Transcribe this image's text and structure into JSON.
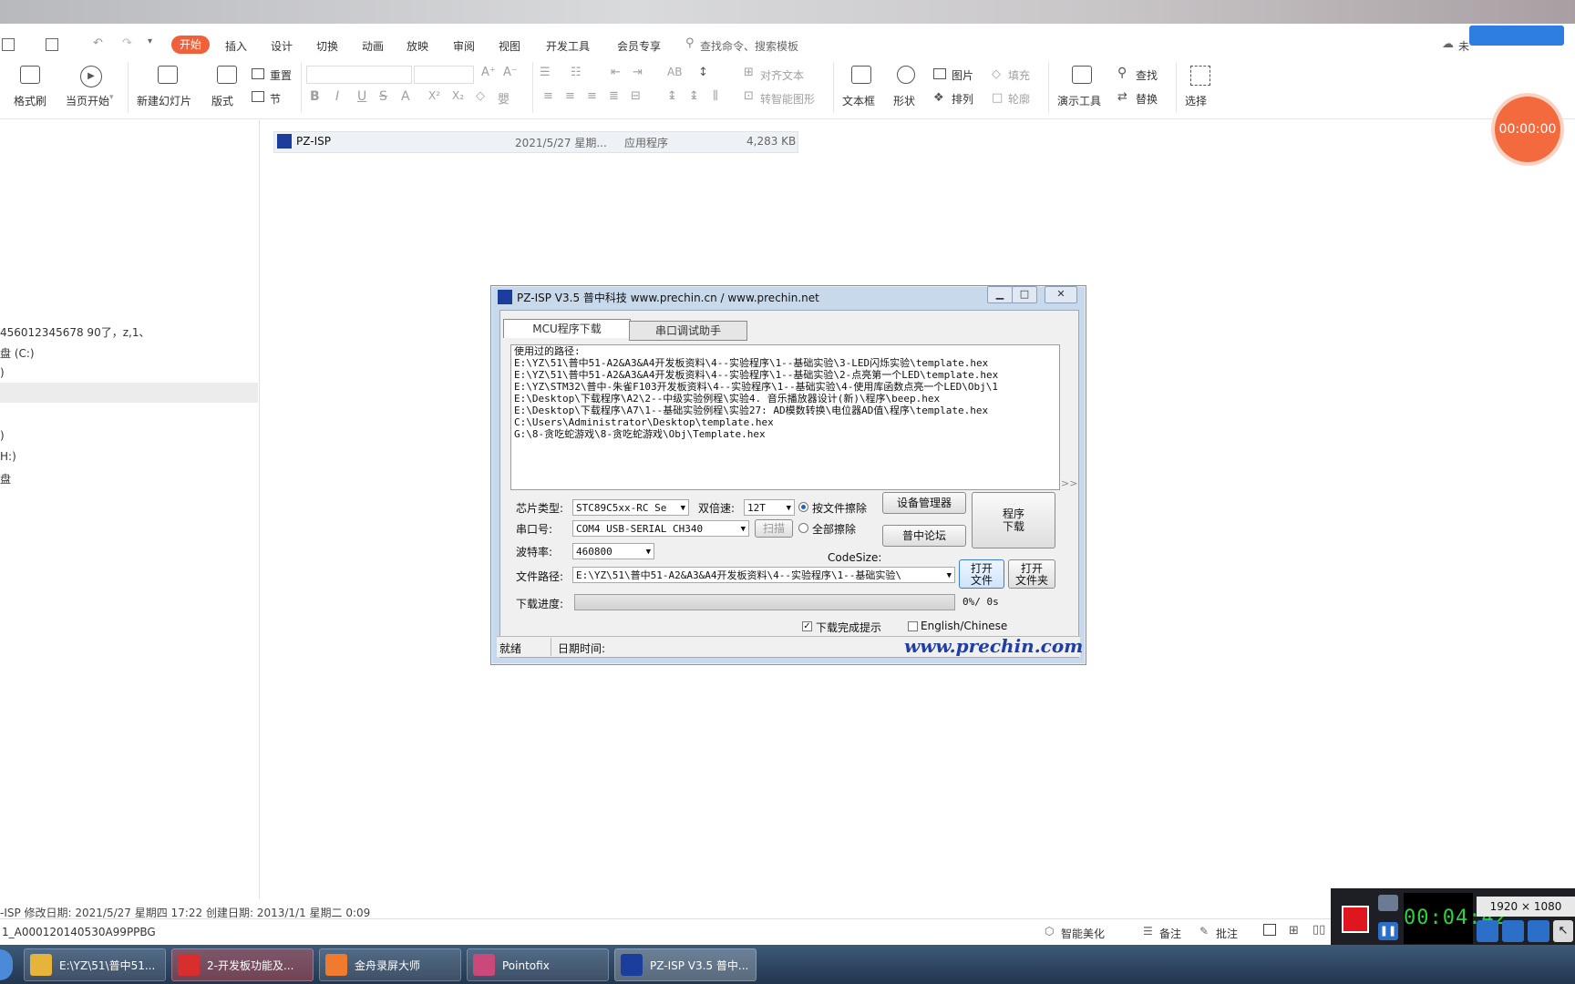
{
  "menu": {
    "items": [
      "开始",
      "插入",
      "设计",
      "切换",
      "动画",
      "放映",
      "审阅",
      "视图",
      "开发工具",
      "会员专享"
    ],
    "search": "查找命令、搜索模板",
    "top_right": "未"
  },
  "ribbon": {
    "format_painter": "格式刷",
    "start_from_current": "当页开始",
    "new_slide": "新建幻灯片",
    "layout": "版式",
    "reset": "重置",
    "section": "节",
    "align_text": "对齐文本",
    "convert_shape": "转智能图形",
    "textbox": "文本框",
    "shape": "形状",
    "picture": "图片",
    "fill": "填充",
    "arrange": "排列",
    "outline": "轮廓",
    "present_tools": "演示工具",
    "find": "查找",
    "replace": "替换",
    "select": "选择"
  },
  "recording_timer": "00:00:00",
  "left_panel": {
    "rows": [
      "456012345678 90了，z,1、",
      "盘 (C:)",
      ")",
      "",
      ")",
      "H:)",
      "盘"
    ]
  },
  "file_row": {
    "name": "PZ-ISP",
    "date": "2021/5/27 星期...",
    "type": "应用程序",
    "size": "4,283 KB"
  },
  "dialog": {
    "title": "PZ-ISP V3.5 普中科技 www.prechin.cn / www.prechin.net",
    "tab_download": "MCU程序下载",
    "tab_serial": "串口调试助手",
    "paths_header": "使用过的路径:",
    "paths": [
      "E:\\YZ\\51\\普中51-A2&A3&A4开发板资料\\4--实验程序\\1--基础实验\\3-LED闪烁实验\\template.hex",
      "E:\\YZ\\51\\普中51-A2&A3&A4开发板资料\\4--实验程序\\1--基础实验\\2-点亮第一个LED\\template.hex",
      "E:\\YZ\\STM32\\普中-朱雀F103开发板资料\\4--实验程序\\1--基础实验\\4-使用库函数点亮一个LED\\Obj\\1",
      "E:\\Desktop\\下载程序\\A2\\2--中级实验例程\\实验4. 音乐播放器设计(新)\\程序\\beep.hex",
      "E:\\Desktop\\下载程序\\A7\\1--基础实验例程\\实验27: AD模数转换\\电位器AD值\\程序\\template.hex",
      "C:\\Users\\Administrator\\Desktop\\template.hex",
      "G:\\8-贪吃蛇游戏\\8-贪吃蛇游戏\\Obj\\Template.hex"
    ],
    "chip_label": "芯片类型:",
    "chip_value": "STC89C5xx-RC Se",
    "speed_label": "双倍速:",
    "speed_value": "12T",
    "erase_by_file": "按文件擦除",
    "erase_all": "全部擦除",
    "device_manager": "设备管理器",
    "forum": "普中论坛",
    "program_download": "程序\n下载",
    "port_label": "串口号:",
    "port_value": "COM4  USB-SERIAL CH340",
    "scan": "扫描",
    "baud_label": "波特率:",
    "baud_value": "460800",
    "codesize": "CodeSize:",
    "filepath_label": "文件路径:",
    "filepath_value": "E:\\YZ\\51\\普中51-A2&A3&A4开发板资料\\4--实验程序\\1--基础实验\\",
    "open_file": "打开\n文件",
    "open_folder": "打开\n文件夹",
    "progress_label": "下载进度:",
    "progress_text": "0%/ 0s",
    "progress_value": 0,
    "done_tip": "下载完成提示",
    "lang": "English/Chinese",
    "status_ready": "就绪",
    "status_datetime": "日期时间:",
    "logo": "www.prechin.com",
    "expander": ">>"
  },
  "wps_status": {
    "file_info": "-ISP   修改日期: 2021/5/27 星期四 17:22  创建日期: 2013/1/1 星期二 0:09",
    "slide_name": "1_A000120140530A99PPBG",
    "beautify": "智能美化",
    "notes": "备注",
    "comments": "批注"
  },
  "recorder": {
    "time": "00:04:42",
    "resolution": "1920 × 1080"
  },
  "taskbar": {
    "items": [
      {
        "label": "E:\\YZ\\51\\普中51...",
        "color": "#e6b33b"
      },
      {
        "label": "2-开发板功能及...",
        "color": "#d92e2e"
      },
      {
        "label": "金舟录屏大师",
        "color": "#f07a2d"
      },
      {
        "label": "Pointofix",
        "color": "#c94a7a"
      },
      {
        "label": "PZ-ISP V3.5 普中...",
        "color": "#1b3d9c"
      }
    ]
  },
  "colors": {
    "accent": "#f0603a",
    "dialog_frame": "#c9d9ec",
    "logo": "#1f3ea8"
  }
}
